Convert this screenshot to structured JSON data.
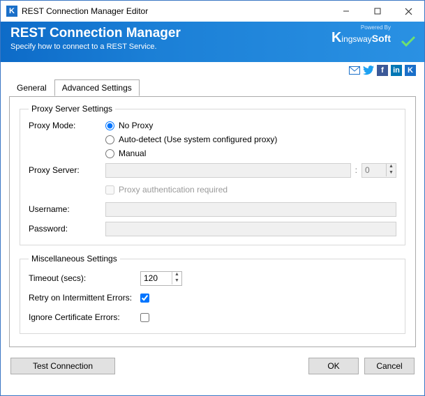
{
  "window": {
    "title": "REST Connection Manager Editor"
  },
  "header": {
    "title": "REST Connection Manager",
    "subtitle": "Specify how to connect to a REST Service.",
    "powered_by": "Powered By",
    "logo_text_1": "K",
    "logo_text_2": "ingsway",
    "logo_text_3": "Soft"
  },
  "tabs": {
    "general": "General",
    "advanced": "Advanced Settings"
  },
  "proxy": {
    "legend": "Proxy Server Settings",
    "mode_label": "Proxy Mode:",
    "options": {
      "no_proxy": "No Proxy",
      "auto": "Auto-detect (Use system configured proxy)",
      "manual": "Manual"
    },
    "selected_mode": "no_proxy",
    "server_label": "Proxy Server:",
    "server_value": "",
    "port_sep": ":",
    "port_value": "0",
    "auth_required_label": "Proxy authentication required",
    "auth_required": false,
    "username_label": "Username:",
    "username_value": "",
    "password_label": "Password:",
    "password_value": ""
  },
  "misc": {
    "legend": "Miscellaneous Settings",
    "timeout_label": "Timeout (secs):",
    "timeout_value": "120",
    "retry_label": "Retry on Intermittent Errors:",
    "retry_checked": true,
    "ignore_cert_label": "Ignore Certificate Errors:",
    "ignore_cert_checked": false
  },
  "buttons": {
    "test": "Test Connection",
    "ok": "OK",
    "cancel": "Cancel"
  }
}
